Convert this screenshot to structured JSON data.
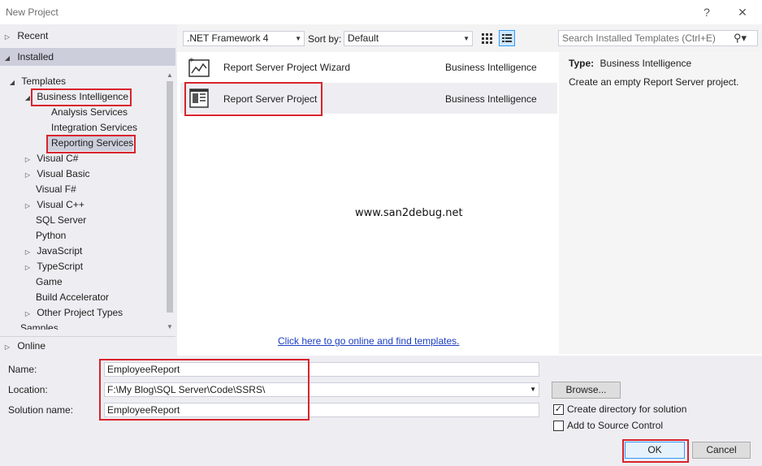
{
  "window": {
    "title": "New Project"
  },
  "nav": {
    "recent": "Recent",
    "installed": "Installed",
    "online": "Online",
    "tree": [
      {
        "label": "Templates"
      },
      {
        "label": "Business Intelligence"
      },
      {
        "label": "Analysis Services"
      },
      {
        "label": "Integration Services"
      },
      {
        "label": "Reporting Services"
      },
      {
        "label": "Visual C#"
      },
      {
        "label": "Visual Basic"
      },
      {
        "label": "Visual F#"
      },
      {
        "label": "Visual C++"
      },
      {
        "label": "SQL Server"
      },
      {
        "label": "Python"
      },
      {
        "label": "JavaScript"
      },
      {
        "label": "TypeScript"
      },
      {
        "label": "Game"
      },
      {
        "label": "Build Accelerator"
      },
      {
        "label": "Other Project Types"
      },
      {
        "label": "Samples"
      }
    ]
  },
  "toolbar": {
    "framework": ".NET Framework 4",
    "sort_label": "Sort by:",
    "sort_value": "Default",
    "search_placeholder": "Search Installed Templates (Ctrl+E)"
  },
  "templates": [
    {
      "name": "Report Server Project Wizard",
      "category": "Business Intelligence",
      "icon": "report-wizard-icon"
    },
    {
      "name": "Report Server Project",
      "category": "Business Intelligence",
      "icon": "report-project-icon"
    }
  ],
  "watermark": "www.san2debug.net",
  "online_link": "Click here to go online and find templates.",
  "details": {
    "type_label": "Type:",
    "type_value": "Business Intelligence",
    "description": "Create an empty Report Server project."
  },
  "form": {
    "name_label": "Name:",
    "name_value": "EmployeeReport",
    "location_label": "Location:",
    "location_value": "F:\\My Blog\\SQL Server\\Code\\SSRS\\",
    "solution_label": "Solution name:",
    "solution_value": "EmployeeReport",
    "browse": "Browse...",
    "create_dir": "Create directory for solution",
    "create_dir_checked": true,
    "add_source": "Add to Source Control",
    "add_source_checked": false,
    "ok": "OK",
    "cancel": "Cancel"
  },
  "colors": {
    "highlight_red": "#d9232d",
    "link_blue": "#1a3dc1",
    "accent": "#3399ff"
  }
}
